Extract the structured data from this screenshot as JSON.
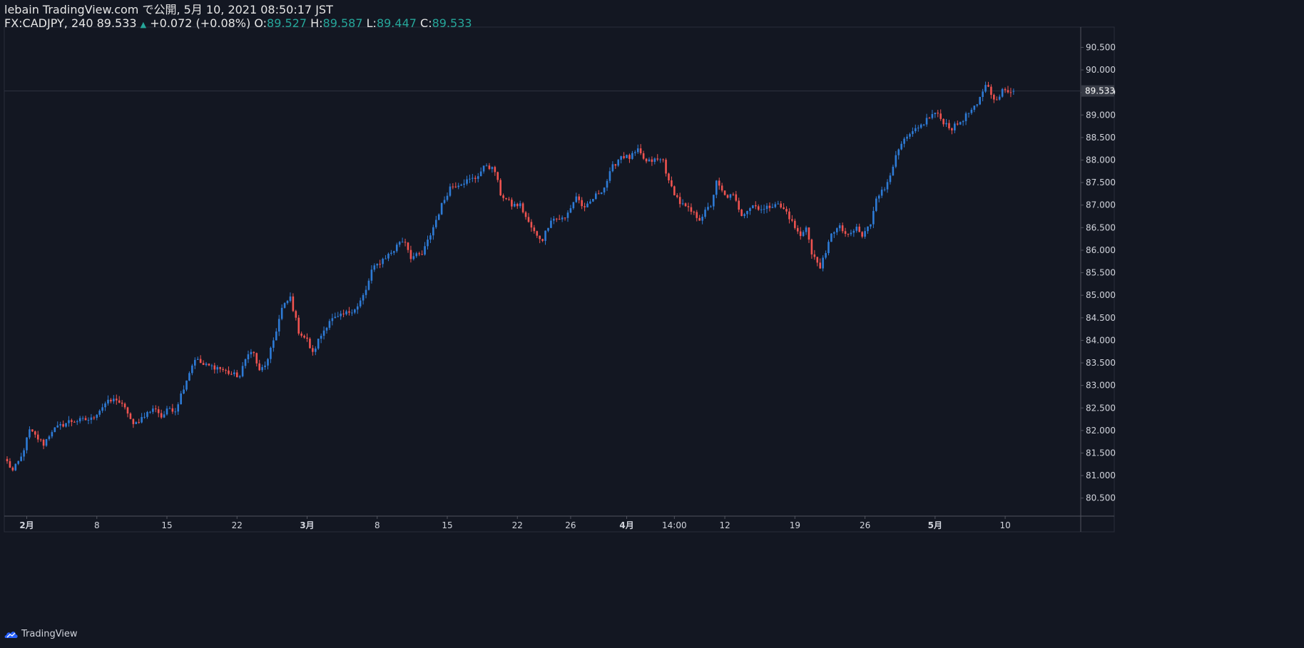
{
  "header": {
    "published": "lebain TradingView.com で公開, 5月 10, 2021 08:50:17 JST",
    "symbol": "FX:CADJPY, 240",
    "last": "89.533",
    "change": "+0.072 (+0.08%)",
    "o_label": "O:",
    "o_value": "89.527",
    "h_label": "H:",
    "h_value": "89.587",
    "l_label": "L:",
    "l_value": "89.447",
    "c_label": "C:",
    "c_value": "89.533"
  },
  "footer": {
    "brand": "TradingView"
  },
  "colors": {
    "background": "#131722",
    "up": "#2e7bd6",
    "down": "#ef5350",
    "text": "#d1d4dc",
    "grid_line": "#363c4e"
  },
  "chart_data": {
    "type": "candlestick",
    "symbol": "FX:CADJPY",
    "interval": "240",
    "ylim": [
      80.1,
      90.95
    ],
    "y_ticks": [
      80.5,
      81.0,
      81.5,
      82.0,
      82.5,
      83.0,
      83.5,
      84.0,
      84.5,
      85.0,
      85.5,
      86.0,
      86.5,
      87.0,
      87.5,
      88.0,
      88.5,
      89.0,
      89.5,
      90.0,
      90.5
    ],
    "y_tick_labels": [
      "80.500",
      "81.000",
      "81.500",
      "82.000",
      "82.500",
      "83.000",
      "83.500",
      "84.000",
      "84.500",
      "85.000",
      "85.500",
      "86.000",
      "86.500",
      "87.000",
      "87.500",
      "88.000",
      "88.500",
      "89.000",
      "89.500",
      "90.000",
      "90.500"
    ],
    "last_price_label": "89.533",
    "x_ticks": [
      {
        "label": "2月",
        "idx": 7,
        "bold": true
      },
      {
        "label": "8",
        "idx": 32,
        "bold": false
      },
      {
        "label": "15",
        "idx": 57,
        "bold": false
      },
      {
        "label": "22",
        "idx": 82,
        "bold": false
      },
      {
        "label": "3月",
        "idx": 107,
        "bold": true
      },
      {
        "label": "8",
        "idx": 132,
        "bold": false
      },
      {
        "label": "15",
        "idx": 157,
        "bold": false
      },
      {
        "label": "22",
        "idx": 182,
        "bold": false
      },
      {
        "label": "26",
        "idx": 201,
        "bold": false
      },
      {
        "label": "4月",
        "idx": 221,
        "bold": true
      },
      {
        "label": "14:00",
        "idx": 238,
        "bold": false
      },
      {
        "label": "12",
        "idx": 256,
        "bold": false
      },
      {
        "label": "19",
        "idx": 281,
        "bold": false
      },
      {
        "label": "26",
        "idx": 306,
        "bold": false
      },
      {
        "label": "5月",
        "idx": 331,
        "bold": true
      },
      {
        "label": "10",
        "idx": 356,
        "bold": false
      }
    ],
    "key_points": [
      [
        0,
        81.3
      ],
      [
        2,
        81.1
      ],
      [
        5,
        81.4
      ],
      [
        8,
        82.0
      ],
      [
        13,
        81.7
      ],
      [
        16,
        82.0
      ],
      [
        22,
        82.2
      ],
      [
        30,
        82.25
      ],
      [
        35,
        82.6
      ],
      [
        39,
        82.7
      ],
      [
        43,
        82.4
      ],
      [
        45,
        82.1
      ],
      [
        49,
        82.35
      ],
      [
        53,
        82.5
      ],
      [
        55,
        82.3
      ],
      [
        58,
        82.5
      ],
      [
        60,
        82.45
      ],
      [
        62,
        82.8
      ],
      [
        65,
        83.3
      ],
      [
        67,
        83.6
      ],
      [
        70,
        83.45
      ],
      [
        75,
        83.4
      ],
      [
        80,
        83.25
      ],
      [
        83,
        83.2
      ],
      [
        86,
        83.75
      ],
      [
        88,
        83.7
      ],
      [
        90,
        83.3
      ],
      [
        93,
        83.55
      ],
      [
        95,
        84.0
      ],
      [
        98,
        84.7
      ],
      [
        101,
        84.95
      ],
      [
        104,
        84.2
      ],
      [
        107,
        84.0
      ],
      [
        109,
        83.7
      ],
      [
        111,
        84.0
      ],
      [
        115,
        84.45
      ],
      [
        118,
        84.5
      ],
      [
        121,
        84.6
      ],
      [
        125,
        84.75
      ],
      [
        128,
        85.1
      ],
      [
        130,
        85.55
      ],
      [
        134,
        85.8
      ],
      [
        138,
        86.0
      ],
      [
        140,
        86.2
      ],
      [
        142,
        86.2
      ],
      [
        144,
        85.85
      ],
      [
        148,
        85.9
      ],
      [
        151,
        86.35
      ],
      [
        155,
        87.0
      ],
      [
        158,
        87.4
      ],
      [
        162,
        87.5
      ],
      [
        167,
        87.6
      ],
      [
        171,
        87.9
      ],
      [
        174,
        87.75
      ],
      [
        176,
        87.25
      ],
      [
        180,
        87.0
      ],
      [
        183,
        87.0
      ],
      [
        186,
        86.6
      ],
      [
        189,
        86.3
      ],
      [
        191,
        86.25
      ],
      [
        194,
        86.7
      ],
      [
        199,
        86.7
      ],
      [
        203,
        87.2
      ],
      [
        206,
        86.9
      ],
      [
        209,
        87.15
      ],
      [
        213,
        87.4
      ],
      [
        216,
        87.85
      ],
      [
        219,
        88.1
      ],
      [
        222,
        88.05
      ],
      [
        225,
        88.2
      ],
      [
        228,
        87.95
      ],
      [
        231,
        88.0
      ],
      [
        234,
        88.0
      ],
      [
        236,
        87.5
      ],
      [
        240,
        87.05
      ],
      [
        244,
        86.85
      ],
      [
        247,
        86.7
      ],
      [
        251,
        87.0
      ],
      [
        253,
        87.5
      ],
      [
        256,
        87.2
      ],
      [
        259,
        87.2
      ],
      [
        262,
        86.8
      ],
      [
        266,
        87.0
      ],
      [
        270,
        86.9
      ],
      [
        274,
        87.05
      ],
      [
        278,
        86.85
      ],
      [
        281,
        86.5
      ],
      [
        283,
        86.3
      ],
      [
        285,
        86.55
      ],
      [
        287,
        85.9
      ],
      [
        290,
        85.65
      ],
      [
        292,
        85.9
      ],
      [
        294,
        86.4
      ],
      [
        297,
        86.5
      ],
      [
        300,
        86.3
      ],
      [
        303,
        86.5
      ],
      [
        305,
        86.3
      ],
      [
        308,
        86.6
      ],
      [
        310,
        87.2
      ],
      [
        313,
        87.35
      ],
      [
        316,
        87.9
      ],
      [
        319,
        88.35
      ],
      [
        322,
        88.55
      ],
      [
        325,
        88.7
      ],
      [
        328,
        88.9
      ],
      [
        331,
        89.05
      ],
      [
        334,
        88.85
      ],
      [
        337,
        88.7
      ],
      [
        340,
        88.85
      ],
      [
        343,
        89.05
      ],
      [
        346,
        89.2
      ],
      [
        349,
        89.7
      ],
      [
        351,
        89.5
      ],
      [
        353,
        89.3
      ],
      [
        355,
        89.533
      ]
    ],
    "last_close": 89.533,
    "last_open": 89.527,
    "last_high": 89.587,
    "last_low": 89.447
  }
}
